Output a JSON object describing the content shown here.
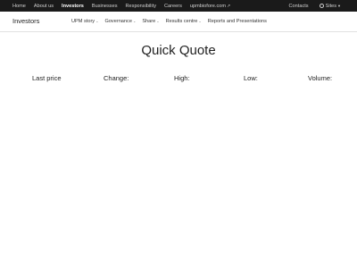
{
  "topnav": {
    "items": [
      "Home",
      "About us",
      "Investors",
      "Businesses",
      "Responsibility",
      "Careers",
      "upmbiofore.com"
    ],
    "active": "Investors",
    "right": {
      "contacts": "Contacts",
      "sites": "Sites"
    }
  },
  "subheader": {
    "title": "Investors",
    "items": [
      "UPM story",
      "Governance",
      "Share",
      "Results centre",
      "Reports and Presentations"
    ]
  },
  "main": {
    "title": "Quick Quote",
    "fields": {
      "last_price": "Last price",
      "change": "Change:",
      "high": "High:",
      "low": "Low:",
      "volume": "Volume:"
    }
  },
  "colors": {
    "topbar_bg": "#1a1a1a",
    "topbar_text": "#d0d0d0",
    "active_text": "#ffffff",
    "divider": "#e2e2e2"
  },
  "icons": {
    "external_link": "external-link-icon",
    "globe": "globe-icon",
    "chevron": "chevron-down-icon"
  }
}
